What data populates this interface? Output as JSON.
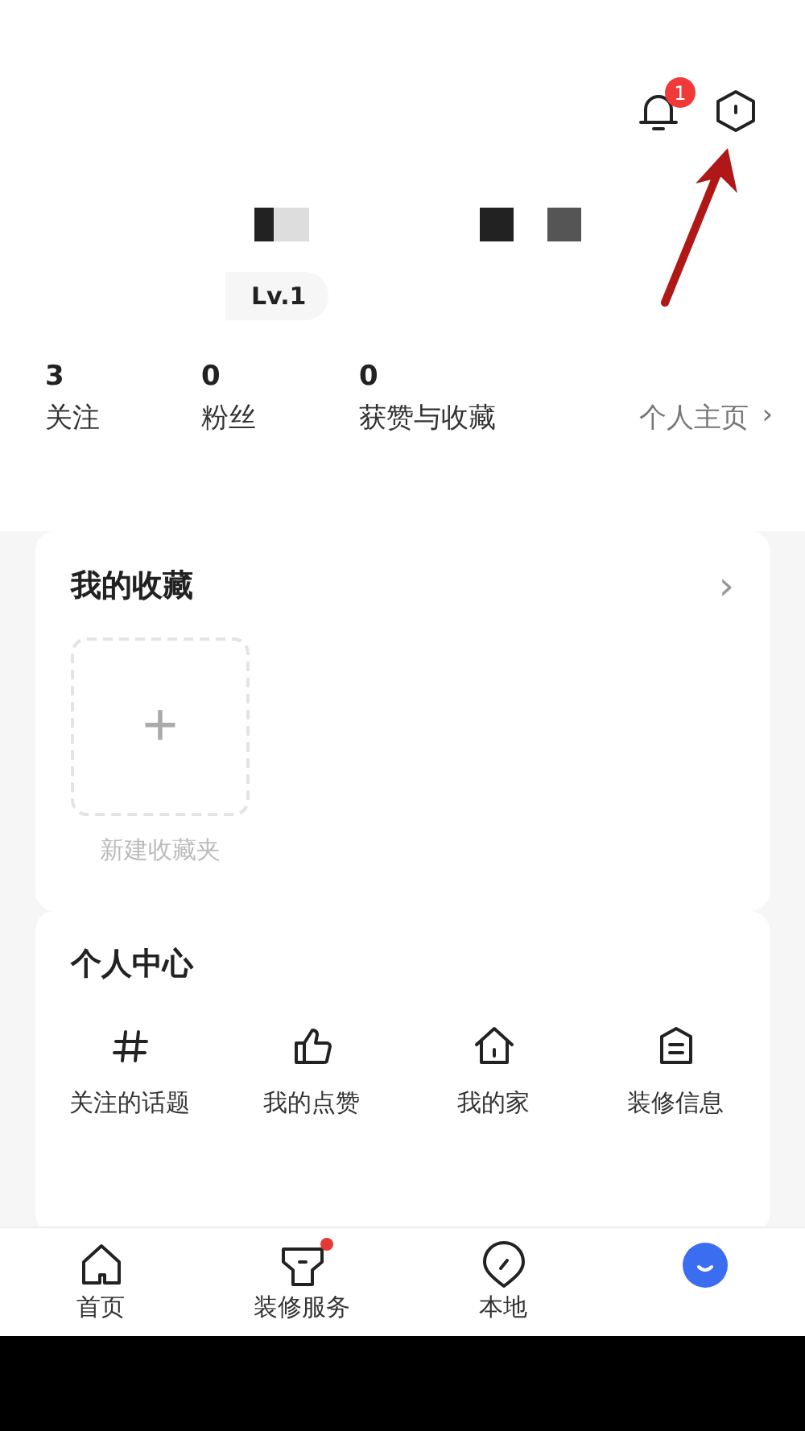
{
  "header": {
    "notification_badge": "1"
  },
  "profile": {
    "level_badge": "Lv.1"
  },
  "stats": [
    {
      "value": "3",
      "label": "关注"
    },
    {
      "value": "0",
      "label": "粉丝"
    },
    {
      "value": "0",
      "label": "获赞与收藏"
    }
  ],
  "homepage_link": {
    "label": "个人主页",
    "arrow": "›"
  },
  "favorites": {
    "title": "我的收藏",
    "arrow": "›",
    "new_folder": {
      "icon": "+",
      "label": "新建收藏夹"
    }
  },
  "personal_center": {
    "title": "个人中心",
    "items": [
      {
        "kind": "hashtag",
        "label": "关注的话题"
      },
      {
        "kind": "thumb",
        "label": "我的点赞"
      },
      {
        "kind": "house",
        "label": "我的家"
      },
      {
        "kind": "tag",
        "label": "装修信息"
      }
    ]
  },
  "bottom_nav": [
    {
      "kind": "home",
      "label": "首页",
      "selected": false,
      "dot": false
    },
    {
      "kind": "service",
      "label": "装修服务",
      "selected": false,
      "dot": true
    },
    {
      "kind": "local",
      "label": "本地",
      "selected": false,
      "dot": false
    },
    {
      "kind": "me",
      "selected": true,
      "dot": false
    }
  ]
}
